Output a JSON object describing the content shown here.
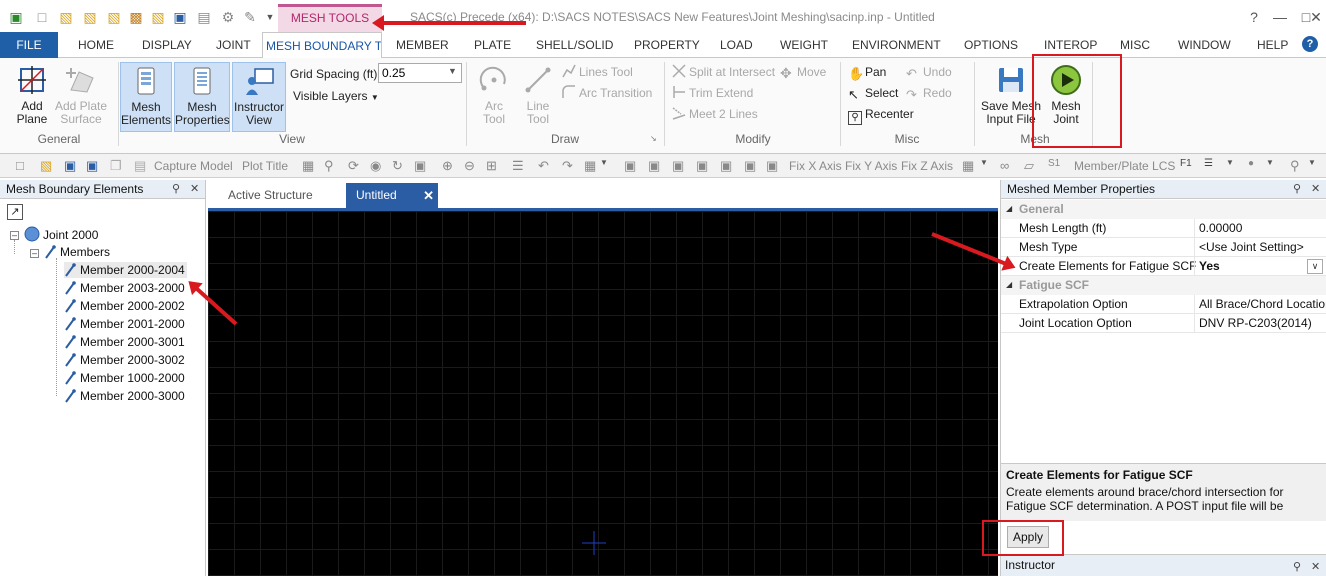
{
  "window": {
    "title": "SACS(c) Precede (x64): D:\\SACS NOTES\\SACS New Features\\Joint Meshing\\sacinp.inp - Untitled",
    "context_tab": "MESH TOOLS"
  },
  "ribbon_tabs": {
    "file": "FILE",
    "home": "HOME",
    "display": "DISPLAY",
    "joint": "JOINT",
    "mesh_boundary": "MESH BOUNDARY TOOLS",
    "member": "MEMBER",
    "plate": "PLATE",
    "shell_solid": "SHELL/SOLID",
    "property": "PROPERTY",
    "load": "LOAD",
    "weight": "WEIGHT",
    "environment": "ENVIRONMENT",
    "options": "OPTIONS",
    "interop": "INTEROP",
    "misc": "MISC",
    "window": "WINDOW",
    "help": "HELP"
  },
  "ribbon": {
    "general": {
      "label": "General",
      "add_plane": "Add Plane",
      "add_plate_surface": "Add Plate Surface"
    },
    "view": {
      "label": "View",
      "mesh_elements": "Mesh Elements",
      "mesh_properties": "Mesh Properties",
      "instructor_view": "Instructor View",
      "grid_spacing_label": "Grid Spacing (ft)",
      "grid_spacing_value": "0.25",
      "visible_layers": "Visible Layers"
    },
    "draw": {
      "label": "Draw",
      "arc_tool": "Arc Tool",
      "line_tool": "Line Tool",
      "lines_tool": "Lines Tool",
      "arc_transition": "Arc Transition"
    },
    "modify": {
      "label": "Modify",
      "split": "Split at Intersect",
      "move": "Move",
      "trim": "Trim Extend",
      "meet": "Meet 2 Lines"
    },
    "misc": {
      "label": "Misc",
      "pan": "Pan",
      "select": "Select",
      "recenter": "Recenter",
      "undo": "Undo",
      "redo": "Redo"
    },
    "mesh": {
      "label": "Mesh",
      "save_mesh": "Save Mesh Input File",
      "mesh_joint": "Mesh Joint"
    }
  },
  "quick_toolbar": {
    "capture_model": "Capture Model",
    "plot_title": "Plot Title",
    "fix_x": "Fix X Axis",
    "fix_y": "Fix Y Axis",
    "fix_z": "Fix Z Axis",
    "member_plate_lcs": "Member/Plate LCS"
  },
  "left_panel": {
    "title": "Mesh Boundary Elements",
    "joint": "Joint 2000",
    "members_label": "Members",
    "members": [
      "Member 2000-2004",
      "Member 2003-2000",
      "Member 2000-2002",
      "Member 2001-2000",
      "Member 2000-3001",
      "Member 2000-3002",
      "Member 1000-2000",
      "Member 2000-3000"
    ]
  },
  "doc_tabs": {
    "active_structure": "Active Structure",
    "untitled": "Untitled"
  },
  "right_panel": {
    "title": "Meshed Member Properties",
    "cat_general": "General",
    "mesh_length_name": "Mesh Length (ft)",
    "mesh_length_value": "0.00000",
    "mesh_type_name": "Mesh Type",
    "mesh_type_value": "<Use Joint Setting>",
    "fatigue_elem_name": "Create Elements for Fatigue SCF",
    "fatigue_elem_value": "Yes",
    "cat_fatigue": "Fatigue SCF",
    "extrap_name": "Extrapolation Option",
    "extrap_value": "All Brace/Chord Locations",
    "joint_loc_name": "Joint Location Option",
    "joint_loc_value": "DNV RP-C203(2014)",
    "desc_title": "Create Elements for Fatigue SCF",
    "desc_text": "Create elements around brace/chord intersection for Fatigue SCF determination. A POST input file will be created for SCF.",
    "apply": "Apply",
    "instructor": "Instructor"
  },
  "colors": {
    "accent": "#1f5fa8",
    "annotation": "#d8191f",
    "context": "#c0578f"
  }
}
